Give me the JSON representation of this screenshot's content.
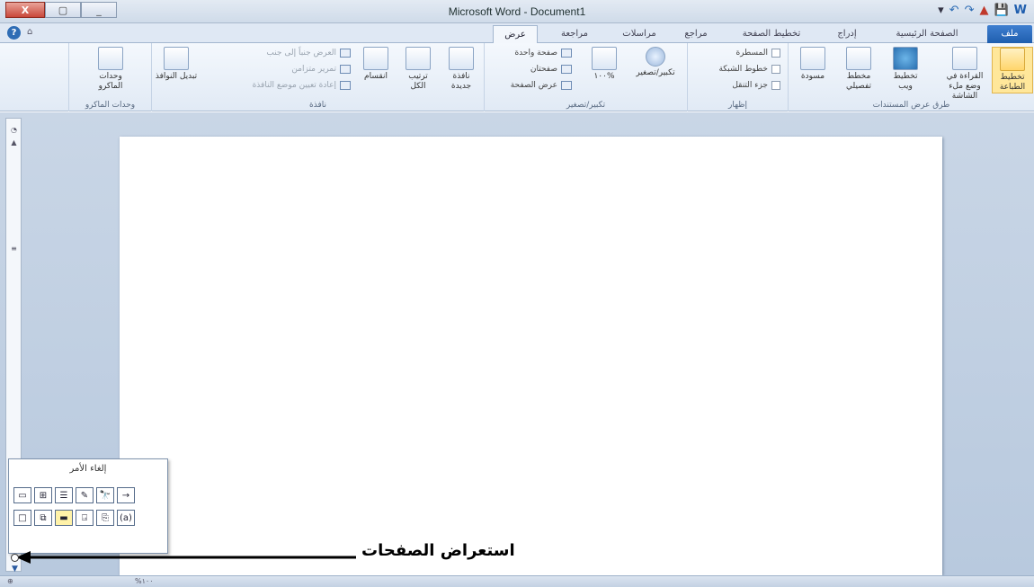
{
  "window": {
    "title": "Microsoft Word - Document1",
    "min_label": "_",
    "restore_label": "▢",
    "close_label": "X"
  },
  "qat": {
    "items": [
      "▾",
      "↶",
      "↷",
      "▲",
      "💾",
      "W"
    ]
  },
  "tabs": {
    "file": "ملف",
    "home": "الصفحة الرئيسية",
    "insert": "إدراج",
    "page_layout": "تخطيط الصفحة",
    "references": "مراجع",
    "mailings": "مراسلات",
    "review": "مراجعة",
    "view": "عرض"
  },
  "ribbon": {
    "views": {
      "group_label": "طرق عرض المستندات",
      "print_layout": "تخطيط الطباعة",
      "full_screen": "القراءة في وضع ملء الشاشة",
      "web_layout": "تخطيط ويب",
      "outline": "مخطط تفصيلي",
      "draft": "مسودة"
    },
    "show": {
      "group_label": "إظهار",
      "ruler": "المسطرة",
      "gridlines": "خطوط الشبكة",
      "nav_pane": "جزء التنقل"
    },
    "zoom": {
      "group_label": "تكبير/تصغير",
      "zoom": "تكبير/تصغير",
      "hundred": "١٠٠%",
      "one_page": "صفحة واحدة",
      "two_pages": "صفحتان",
      "page_width": "عرض الصفحة"
    },
    "window": {
      "group_label": "نافذة",
      "new_window": "نافذة جديدة",
      "arrange_all": "ترتيب الكل",
      "split": "انقسام",
      "side_by_side": "العرض جنباً إلى جنب",
      "sync_scroll": "تمرير متزامن",
      "reset_position": "إعادة تعيين موضع النافذة",
      "switch_windows": "تبديل النوافذ"
    },
    "macros": {
      "group_label": "وحدات الماكرو",
      "macros": "وحدات الماكرو"
    }
  },
  "popup": {
    "title": "إلغاء الأمر",
    "row1": [
      "→",
      "🔭",
      "✎",
      "☰",
      "⊞",
      "▭"
    ],
    "row2": [
      "(a)",
      "⎘",
      "⍈",
      "▬",
      "⧉",
      "□"
    ]
  },
  "annotation": {
    "text": "استعراض الصفحات"
  },
  "statusbar": {
    "zoom_pct": "%١٠٠"
  }
}
